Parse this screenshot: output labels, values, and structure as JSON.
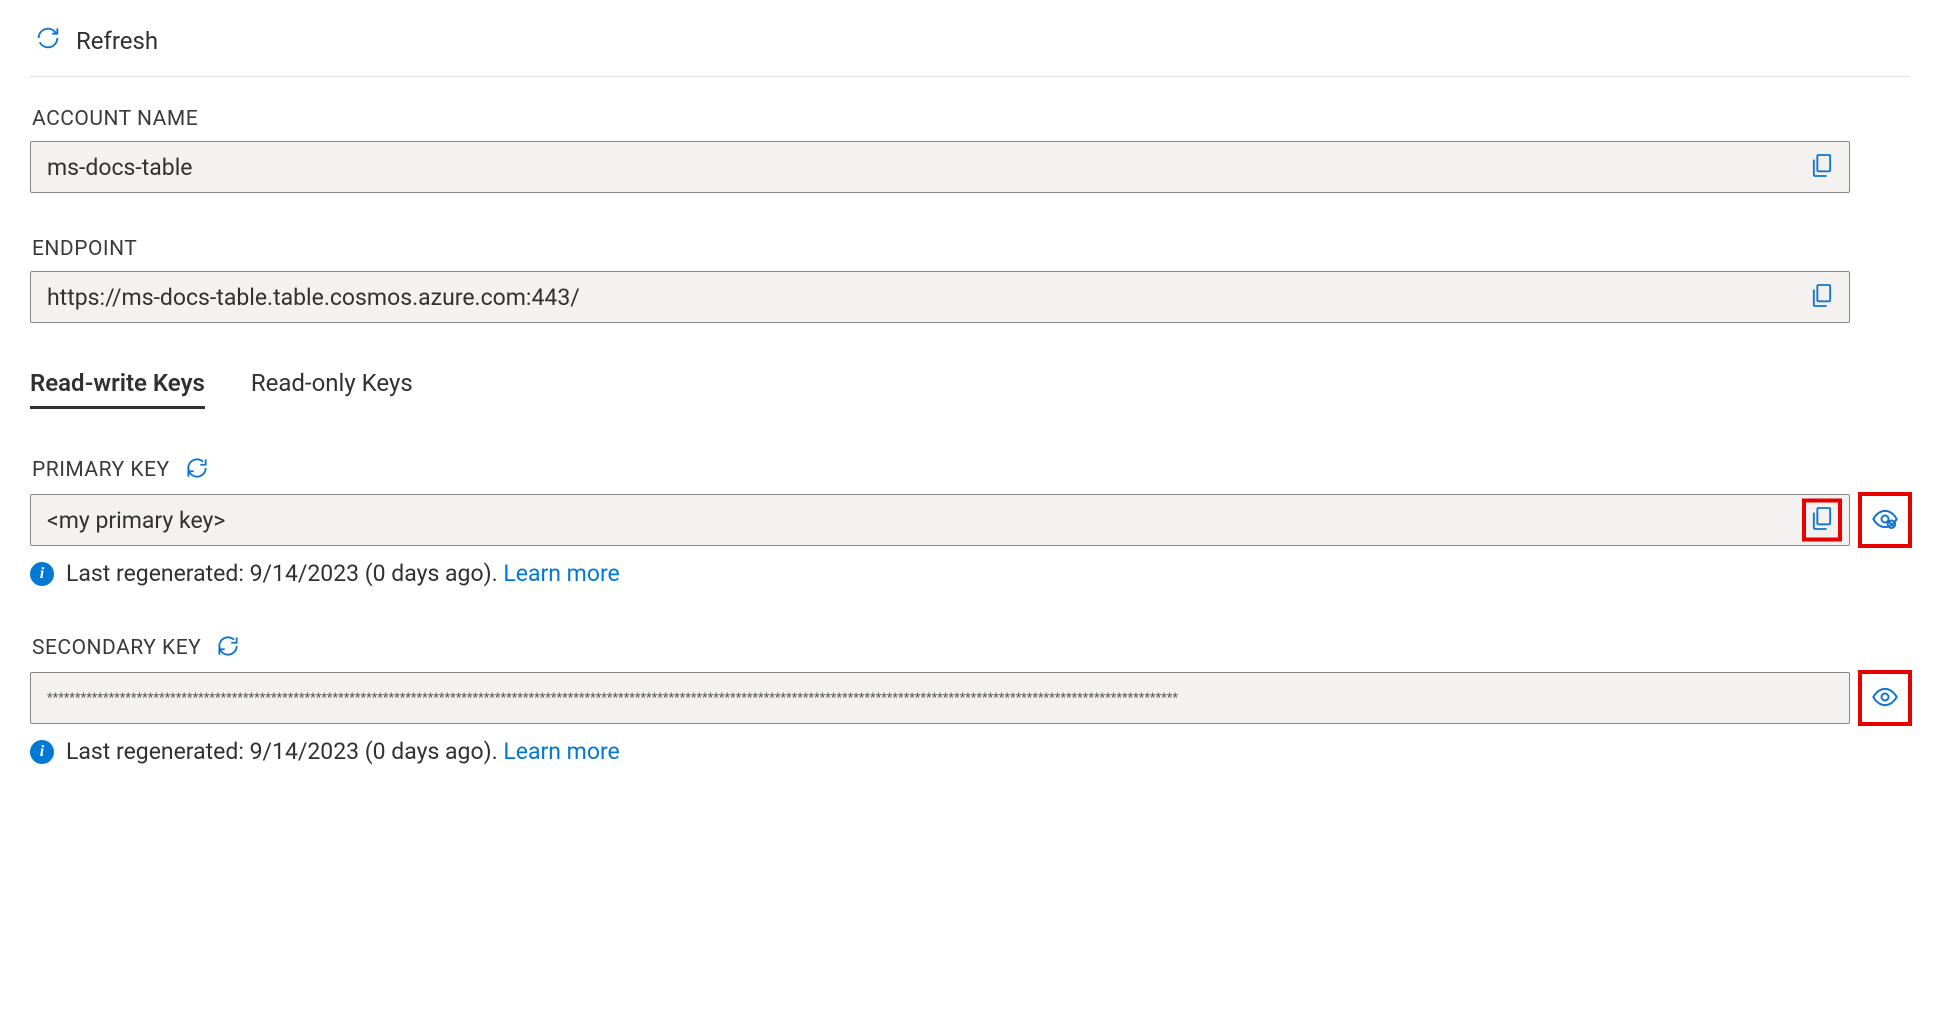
{
  "toolbar": {
    "refresh_label": "Refresh"
  },
  "fields": {
    "account_name": {
      "label": "ACCOUNT NAME",
      "value": "ms-docs-table"
    },
    "endpoint": {
      "label": "ENDPOINT",
      "value": "https://ms-docs-table.table.cosmos.azure.com:443/"
    },
    "primary_key": {
      "label": "PRIMARY KEY",
      "value": "<my primary key>",
      "info_prefix": "Last regenerated: 9/14/2023 (0 days ago). ",
      "learn_more": "Learn more"
    },
    "secondary_key": {
      "label": "SECONDARY KEY",
      "value": "**********************************************************************************************************************************************************************************************************",
      "info_prefix": "Last regenerated: 9/14/2023 (0 days ago). ",
      "learn_more": "Learn more"
    }
  },
  "tabs": {
    "read_write": "Read-write Keys",
    "read_only": "Read-only Keys"
  }
}
